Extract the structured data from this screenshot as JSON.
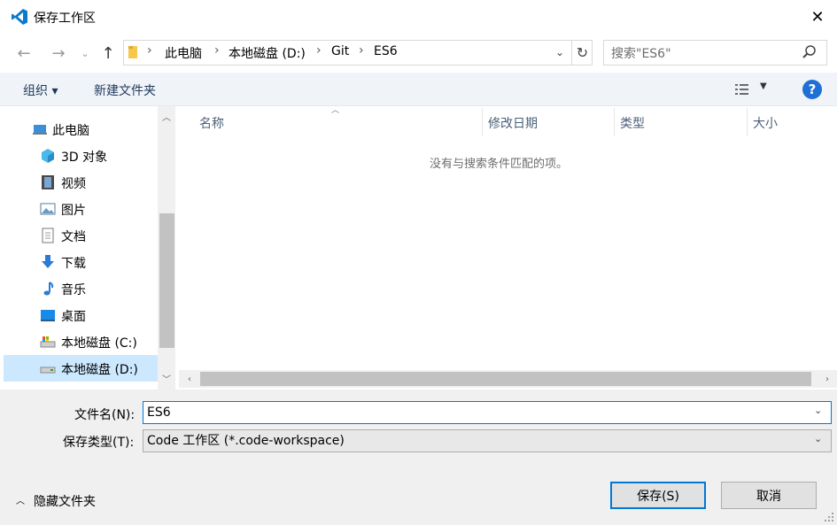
{
  "window": {
    "title": "保存工作区",
    "close_icon": "close-icon"
  },
  "nav": {
    "breadcrumbs": [
      "此电脑",
      "本地磁盘 (D:)",
      "Git",
      "ES6"
    ],
    "search_placeholder": "搜索\"ES6\""
  },
  "toolbar": {
    "organize_label": "组织 ▾",
    "new_folder_label": "新建文件夹",
    "help_label": "?"
  },
  "sidebar": {
    "items": [
      {
        "label": "此电脑",
        "icon": "computer-icon"
      },
      {
        "label": "3D 对象",
        "icon": "cube-3d-icon"
      },
      {
        "label": "视频",
        "icon": "video-icon"
      },
      {
        "label": "图片",
        "icon": "picture-icon"
      },
      {
        "label": "文档",
        "icon": "document-icon"
      },
      {
        "label": "下载",
        "icon": "download-icon"
      },
      {
        "label": "音乐",
        "icon": "music-icon"
      },
      {
        "label": "桌面",
        "icon": "desktop-icon"
      },
      {
        "label": "本地磁盘 (C:)",
        "icon": "drive-c-icon"
      },
      {
        "label": "本地磁盘 (D:)",
        "icon": "drive-d-icon",
        "selected": true
      }
    ]
  },
  "filelist": {
    "columns": [
      "名称",
      "修改日期",
      "类型",
      "大小"
    ],
    "empty_message": "没有与搜索条件匹配的项。"
  },
  "form": {
    "filename_label": "文件名(N):",
    "filename_value": "ES6",
    "filetype_label": "保存类型(T):",
    "filetype_value": "Code 工作区 (*.code-workspace)"
  },
  "footer": {
    "hide_folders_label": "隐藏文件夹",
    "save_label": "保存(S)",
    "cancel_label": "取消"
  },
  "colors": {
    "accent": "#0078d7",
    "selection": "#cce8ff",
    "toolbar_bg": "#f0f4f9",
    "help_blue": "#1e6fd6"
  }
}
